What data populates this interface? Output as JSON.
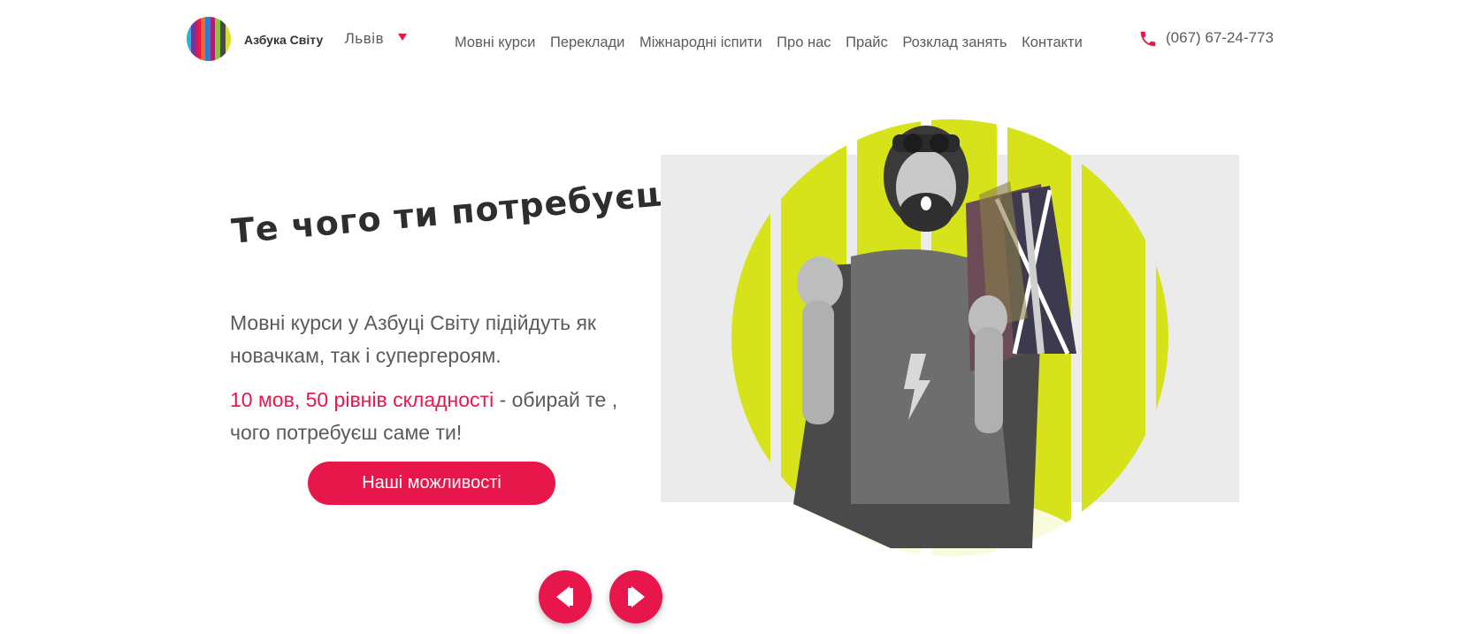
{
  "header": {
    "brand": "Азбука Світу",
    "city": "Львів",
    "nav": [
      "Мовні курси",
      "Переклади",
      "Міжнародні іспити",
      "Про нас",
      "Прайс",
      "Розклад занять",
      "Контакти"
    ],
    "phone": "(067) 67-24-773"
  },
  "hero": {
    "title": "Те чого ти потребуєш!",
    "description": "Мовні курси у Азбуці Світу підійдуть як новачкам, так і супергероям.",
    "highlight": "10 мов, 50 рівнів складності",
    "description_rest": " - обирай те , чого потребуєш саме ти!",
    "cta_label": "Наші можливості"
  },
  "icons": {
    "phone": "phone-icon",
    "prev": "arrow-left-icon",
    "next": "arrow-right-icon",
    "caret": "caret-down-icon"
  },
  "colors": {
    "accent": "#e8174b",
    "lime": "#d6e21a",
    "text": "#5b5b5b"
  }
}
